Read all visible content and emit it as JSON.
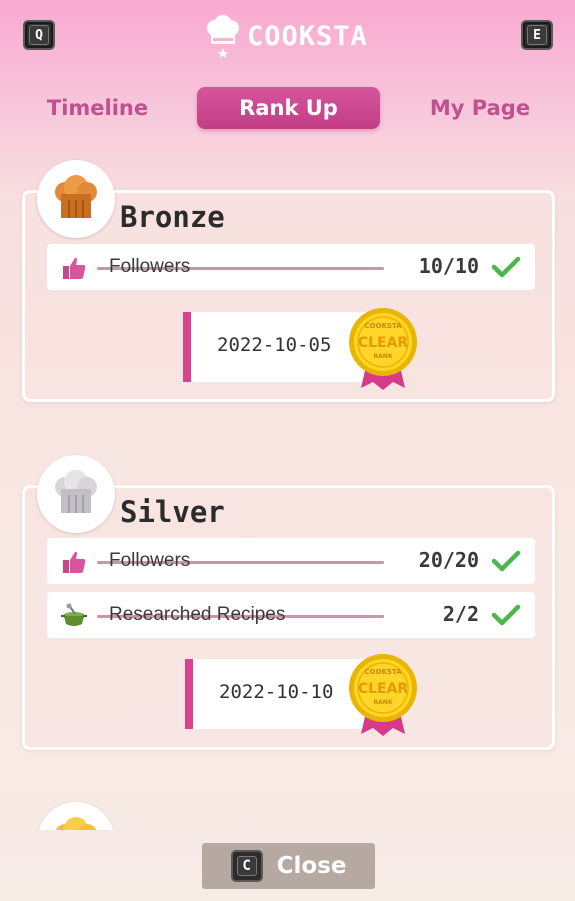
{
  "header": {
    "brand": "COOKSTA",
    "key_left": "Q",
    "key_right": "E"
  },
  "tabs": [
    {
      "label": "Timeline",
      "active": false
    },
    {
      "label": "Rank Up",
      "active": true
    },
    {
      "label": "My Page",
      "active": false
    }
  ],
  "ranks": [
    {
      "name": "Bronze",
      "requirements": [
        {
          "label": "Followers",
          "progress": "10/10",
          "icon": "thumbs-up-icon",
          "done": true
        }
      ],
      "date": "2022-10-05",
      "badge": {
        "line1": "COOKSTA",
        "line2": "CLEAR",
        "line3": "RANK"
      }
    },
    {
      "name": "Silver",
      "requirements": [
        {
          "label": "Followers",
          "progress": "20/20",
          "icon": "thumbs-up-icon",
          "done": true
        },
        {
          "label": "Researched Recipes",
          "progress": "2/2",
          "icon": "cooking-pot-icon",
          "done": true
        }
      ],
      "date": "2022-10-10",
      "badge": {
        "line1": "COOKSTA",
        "line2": "CLEAR",
        "line3": "RANK"
      }
    }
  ],
  "footer": {
    "close_key": "C",
    "close_label": "Close"
  },
  "colors": {
    "accent": "#c8478e",
    "check": "#4bb84b",
    "strike": "#c6809d"
  }
}
